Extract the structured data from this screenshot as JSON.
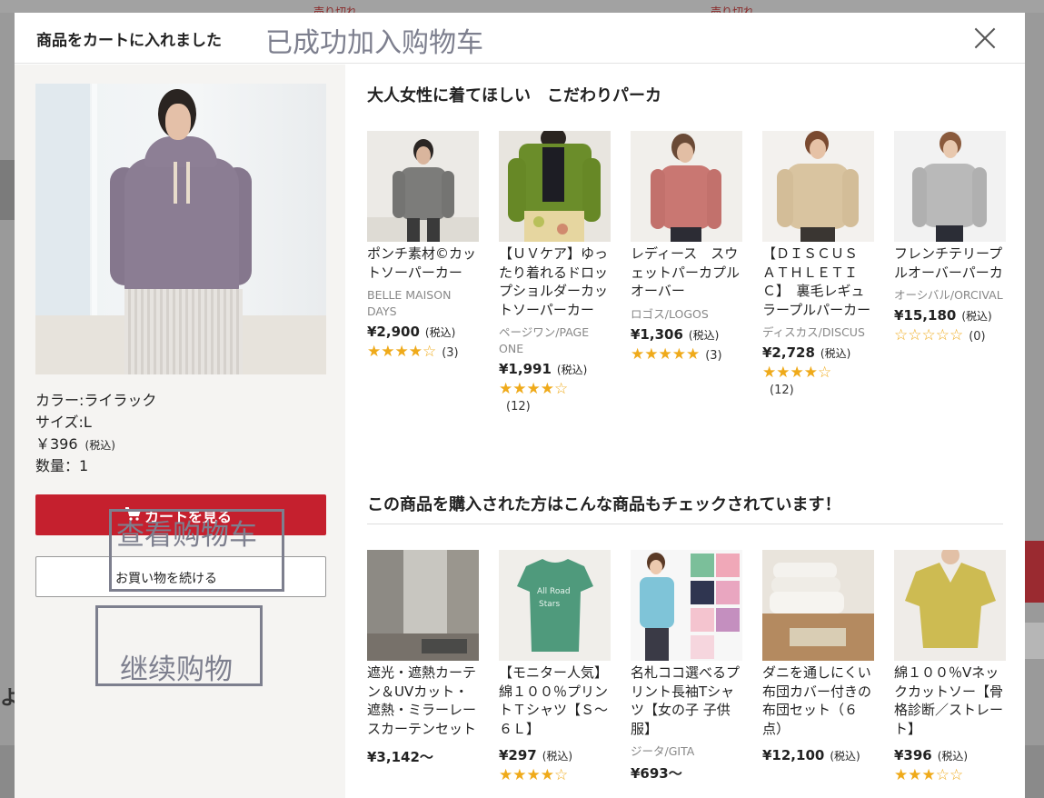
{
  "background": {
    "text_left": "売り切れ",
    "text_right": "売り切れ",
    "left_edge_text": "よ"
  },
  "modal": {
    "title": "商品をカートに入れました",
    "title_overlay": "已成功加入购物车",
    "close_icon": "close-icon"
  },
  "added_item": {
    "color": "カラー:ライラック",
    "size": "サイズ:L",
    "price": "￥396",
    "tax": "(税込)",
    "quantity": "数量：1"
  },
  "buttons": {
    "view_cart": "カートを見る",
    "view_cart_overlay": "查看购物车",
    "continue": "お買い物を続ける",
    "continue_overlay": "继续购物"
  },
  "colors": {
    "accent": "#c5202e",
    "star": "#efaa1a",
    "overlay": "#7d7f8e"
  },
  "section1": {
    "heading": "大人女性に着てほしい　こだわりパーカ",
    "items": [
      {
        "name": "ポンチ素材©カットソーパーカー",
        "brand": "BELLE MAISON DAYS",
        "price": "¥2,900",
        "tax": "(税込)",
        "stars": 4,
        "count": "(3)"
      },
      {
        "name": "【ＵＶケア】ゆったり着れるドロップショルダーカットソーパーカー",
        "brand": "ページワン/PAGE ONE",
        "price": "¥1,991",
        "tax": "(税込)",
        "stars": 4,
        "count": "(12)"
      },
      {
        "name": "レディース　スウェットパーカプルオーバー",
        "brand": "ロゴス/LOGOS",
        "price": "¥1,306",
        "tax": "(税込)",
        "stars": 5,
        "count": "(3)"
      },
      {
        "name": "【ＤＩＳＣＵＳ ＡＴＨＬＥＴＩＣ】　裏毛レギュラープルパーカー",
        "brand": "ディスカス/DISCUS",
        "price": "¥2,728",
        "tax": "(税込)",
        "stars": 4,
        "count": "(12)"
      },
      {
        "name": "フレンチテリープルオーバーパーカ",
        "brand": "オーシバル/ORCIVAL",
        "price": "¥15,180",
        "tax": "(税込)",
        "stars": 0,
        "count": "(0)"
      }
    ]
  },
  "section2": {
    "heading": "この商品を購入された方はこんな商品もチェックされています！",
    "items": [
      {
        "name": "遮光・遮熱カーテン＆UVカット・遮熱・ミラーレースカーテンセット",
        "brand": "",
        "price": "¥3,142〜",
        "tax": "",
        "stars": 0,
        "count": ""
      },
      {
        "name": "【モニター人気】綿１００％プリントＴシャツ【Ｓ～６Ｌ】",
        "brand": "",
        "price": "¥297",
        "tax": "(税込)",
        "stars": 4,
        "count": ""
      },
      {
        "name": "名札ココ選べるプリント長袖Tシャツ【女の子 子供服】",
        "brand": "ジータ/GITA",
        "price": "¥693〜",
        "tax": "",
        "stars": 0,
        "count": ""
      },
      {
        "name": "ダニを通しにくい布団カバー付きの布団セット（６点）",
        "brand": "",
        "price": "¥12,100",
        "tax": "(税込)",
        "stars": 0,
        "count": ""
      },
      {
        "name": "綿１００％Vネックカットソー【骨格診断／ストレート】",
        "brand": "",
        "price": "¥396",
        "tax": "(税込)",
        "stars": 3,
        "count": ""
      }
    ]
  }
}
